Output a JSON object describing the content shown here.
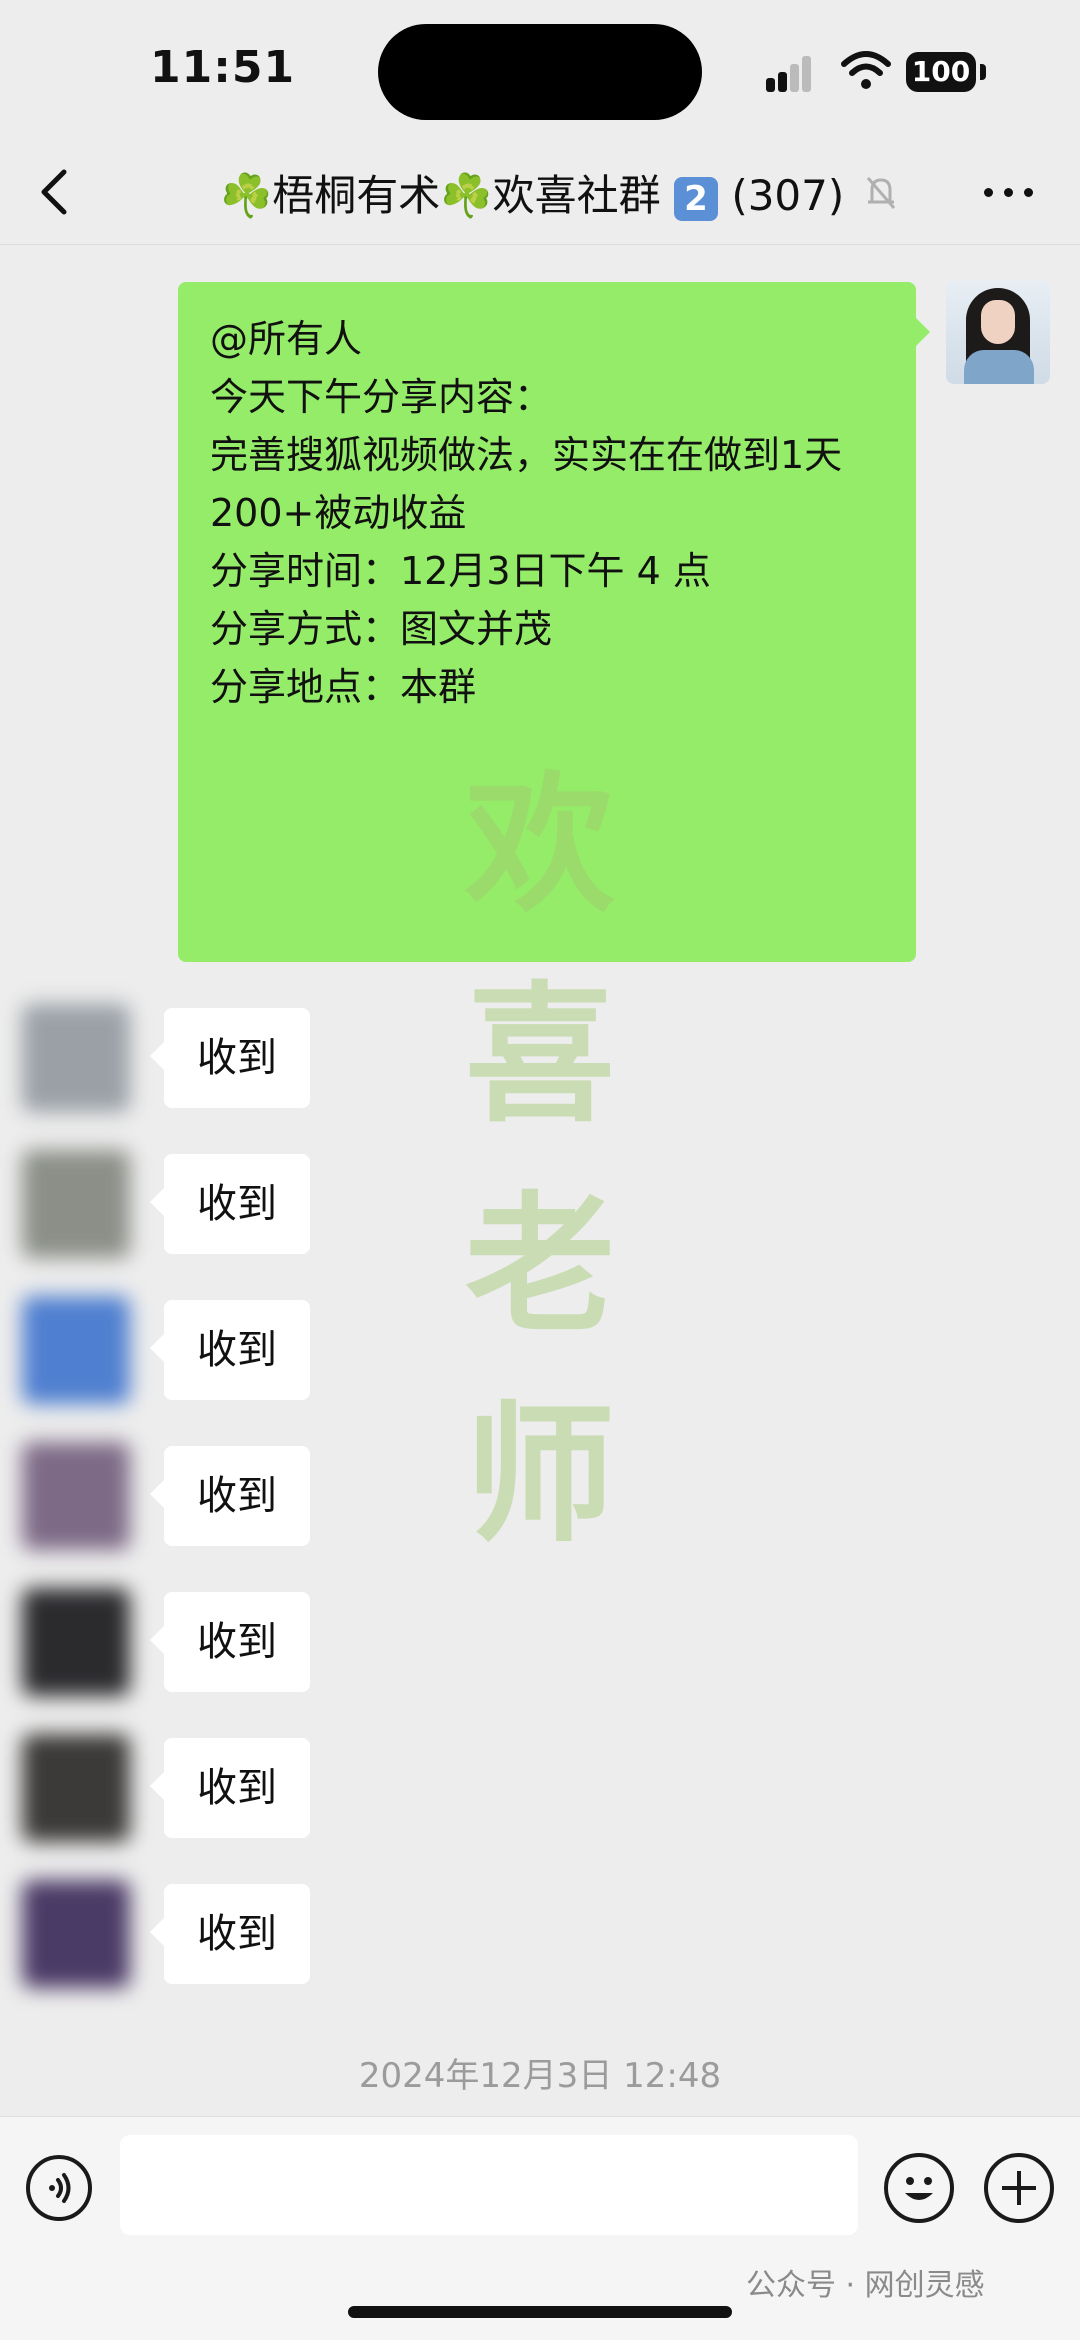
{
  "status_bar": {
    "time": "11:51",
    "battery": "100"
  },
  "header": {
    "title_prefix": "☘️梧桐有术☘️欢喜社群",
    "title_badge": "2",
    "member_count": "(307)"
  },
  "self_message": {
    "lines": [
      "@所有人",
      "",
      "今天下午分享内容：",
      "",
      "完善搜狐视频做法，实实在在做到1天200+被动收益",
      "",
      "分享时间：12月3日下午 4 点",
      "",
      "分享方式：图文并茂",
      "分享地点：本群"
    ]
  },
  "replies": [
    {
      "text": "收到",
      "avatar_color": "#9aa0a6"
    },
    {
      "text": "收到",
      "avatar_color": "#8b8f88"
    },
    {
      "text": "收到",
      "avatar_color": "#4f7fd0"
    },
    {
      "text": "收到",
      "avatar_color": "#7d6a86"
    },
    {
      "text": "收到",
      "avatar_color": "#2b2b2e"
    },
    {
      "text": "收到",
      "avatar_color": "#3c3a38"
    },
    {
      "text": "收到",
      "avatar_color": "#4a3a66"
    }
  ],
  "watermark": [
    "欢",
    "喜",
    "老",
    "师"
  ],
  "timestamp": "2024年12月3日 12:48",
  "credit": "公众号 · 网创灵感",
  "colors": {
    "self_bubble": "#95ec69",
    "background": "#ededed",
    "badge": "#5b8fd6"
  }
}
